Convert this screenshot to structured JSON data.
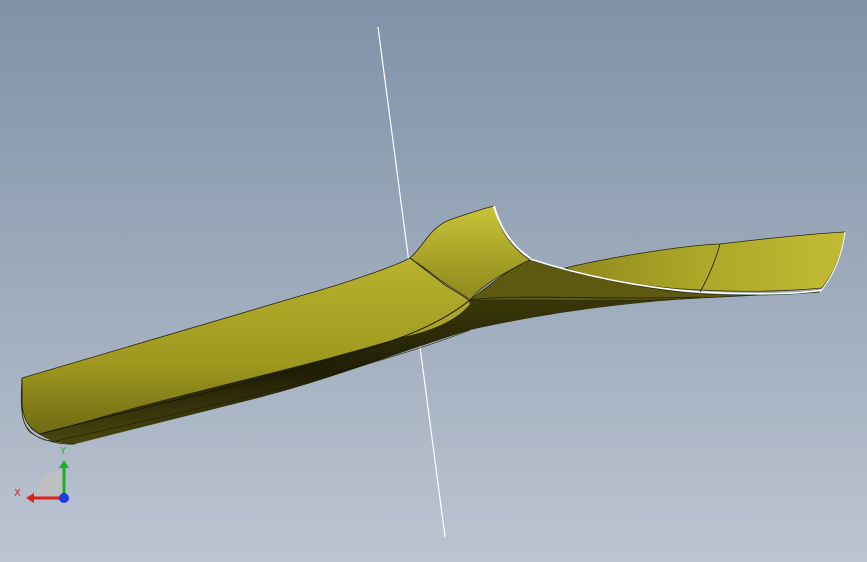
{
  "viewport": {
    "background_top": "#7f92a8",
    "background_bottom": "#bcc4d1"
  },
  "model": {
    "surface_color": "#a7a12a",
    "surface_shadow": "#35330a",
    "edge_color": "#1a1a0a",
    "highlight_color": "#ffffff"
  },
  "triad": {
    "x_label": "X",
    "y_label": "Y",
    "x_color": "#e0201c",
    "y_color": "#18b224",
    "z_color": "#1d3be0"
  }
}
